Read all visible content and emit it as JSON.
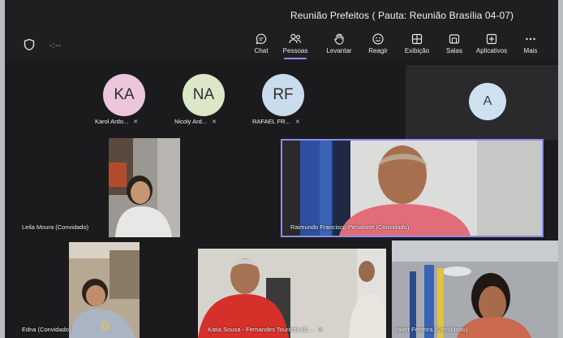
{
  "meeting": {
    "title": "Reunião Prefeitos ( Pauta: Reunião Brasília 04-07)",
    "timer": "-:--"
  },
  "toolbar": {
    "items": [
      {
        "label": "Chat",
        "icon": "chat-icon"
      },
      {
        "label": "Pessoas",
        "icon": "people-icon",
        "active": true
      },
      {
        "label": "Levantar",
        "icon": "raise-hand-icon"
      },
      {
        "label": "Reagir",
        "icon": "react-smile-icon"
      },
      {
        "label": "Exibição",
        "icon": "view-grid-icon"
      },
      {
        "label": "Salas",
        "icon": "rooms-icon"
      },
      {
        "label": "Aplicativos",
        "icon": "apps-plus-icon"
      },
      {
        "label": "Mais",
        "icon": "more-dots-icon"
      }
    ]
  },
  "avatars": [
    {
      "initials": "KA",
      "name": "Karol Ardo...",
      "color": "#ecc6dd"
    },
    {
      "initials": "NA",
      "name": "Nicoly Ard...",
      "color": "#dbe7c6"
    },
    {
      "initials": "RF",
      "name": "RAFAEL FR...",
      "color": "#c9dcec"
    },
    {
      "initials": "A",
      "name": "",
      "color": "#cfe0ef"
    }
  ],
  "participants": [
    {
      "name": "Leila Moura (Convidado)"
    },
    {
      "name": "Raimundo Francisco Penaforte (Convidado)",
      "speaking": true
    },
    {
      "name": "Edna (Convidado)"
    },
    {
      "name": "Katia Sousa - Fernandes Tourinho (C..."
    },
    {
      "name": "Valter Ferreira (Convidado)"
    }
  ],
  "colors": {
    "accent": "#8b8cf0",
    "background": "#1b1b1d"
  }
}
